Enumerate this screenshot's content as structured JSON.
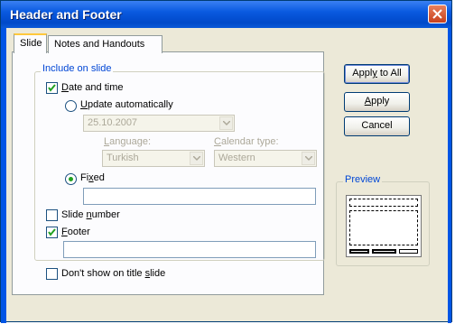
{
  "window": {
    "title": "Header and Footer"
  },
  "tabs": [
    {
      "label": "Slide"
    },
    {
      "label": "Notes and Handouts"
    }
  ],
  "include_group": {
    "legend": "Include on slide"
  },
  "date_time": {
    "label_pre": "",
    "label_ul": "D",
    "label_post": "ate and time",
    "checked": true,
    "update_auto": {
      "label_ul": "U",
      "label_post": "pdate automatically",
      "selected": false
    },
    "date_value": "25.10.2007",
    "language_label": "Language:",
    "language_value": "Turkish",
    "calendar_label": "Calendar type:",
    "calendar_value": "Western",
    "fixed": {
      "label_pre": "Fi",
      "label_ul": "x",
      "label_post": "ed",
      "selected": true,
      "value": ""
    }
  },
  "slide_number": {
    "label_pre": "Slide ",
    "label_ul": "n",
    "label_post": "umber",
    "checked": false
  },
  "footer": {
    "label_ul": "F",
    "label_post": "ooter",
    "checked": true,
    "value": ""
  },
  "dont_show": {
    "label_pre": "Don't show on title ",
    "label_ul": "s",
    "label_post": "lide",
    "checked": false
  },
  "buttons": {
    "apply_all": {
      "pre": "Appl",
      "ul": "y",
      "post": " to All"
    },
    "apply": {
      "pre": "",
      "ul": "A",
      "post": "pply"
    },
    "cancel": "Cancel"
  },
  "preview": {
    "legend": "Preview"
  },
  "colors": {
    "title_bar": "#0a5ae0",
    "legend_text": "#0046d5",
    "radio_dot": "#21a121",
    "close_button": "#c8401c"
  }
}
